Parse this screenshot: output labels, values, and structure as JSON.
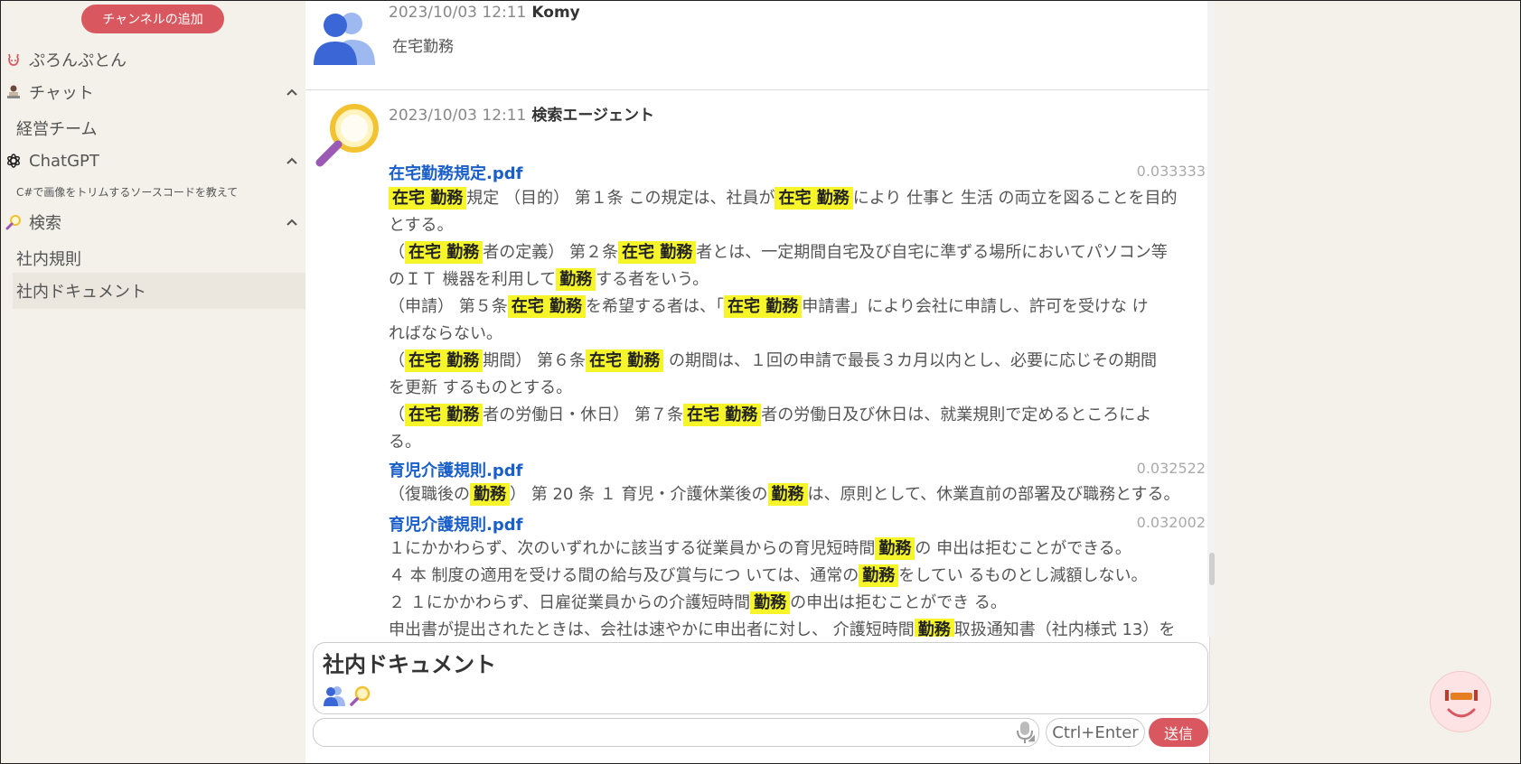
{
  "sidebar": {
    "add_channel": "チャンネルの追加",
    "items": [
      {
        "label": "ぷろんぷとん",
        "icon": "devil-face-icon"
      },
      {
        "label": "チャット",
        "icon": "person-at-desk-icon"
      },
      {
        "label": "経営チーム"
      },
      {
        "label": "ChatGPT",
        "icon": "openai-logo-icon"
      },
      {
        "label": "C#で画像をトリムするソースコードを教えて"
      },
      {
        "label": "検索",
        "icon": "magnifier-icon"
      },
      {
        "label": "社内規則"
      },
      {
        "label": "社内ドキュメント"
      }
    ]
  },
  "messages": {
    "user": {
      "timestamp": "2023/10/03 12:11",
      "name": "Komy",
      "text": "在宅勤務"
    },
    "agent": {
      "timestamp": "2023/10/03 12:11",
      "name": "検索エージェント"
    }
  },
  "results": {
    "r1": {
      "file": "在宅勤務規定.pdf",
      "score": "0.033333",
      "l1": {
        "h1": "在宅 勤務",
        "t1": "規定 （目的） 第１条 この規定は、社員が",
        "h2": "在宅 勤務",
        "t2": "により 仕事と 生活 の両立を図ることを目的"
      },
      "l2": {
        "t1": "とする。"
      },
      "l3": {
        "t0": "（",
        "h1": "在宅 勤務",
        "t1": "者の定義） 第２条",
        "h2": "在宅 勤務",
        "t2": "者とは、一定期間自宅及び自宅に準ずる場所においてパソコン等"
      },
      "l4": {
        "t0": "のＩＴ 機器を利用して",
        "h1": "勤務",
        "t1": "する者をいう。"
      },
      "l5": {
        "t0": "（申請） 第５条",
        "h1": "在宅 勤務",
        "t1": "を希望する者は、「",
        "h2": "在宅 勤務",
        "t2": "申請書」により会社に申請し、許可を受けな け"
      },
      "l6": {
        "t0": "ればならない。"
      },
      "l7": {
        "t0": "（",
        "h1": "在宅 勤務",
        "t1": "期間） 第６条",
        "h2": "在宅 勤務",
        "t2": " の期間は、１回の申請で最長３カ月以内とし、必要に応じその期間"
      },
      "l8": {
        "t0": "を更新 するものとする。"
      },
      "l9": {
        "t0": "（",
        "h1": "在宅 勤務",
        "t1": "者の労働日・休日） 第７条",
        "h2": "在宅 勤務",
        "t2": "者の労働日及び休日は、就業規則で定めるところによ"
      },
      "l10": {
        "t0": "る。"
      }
    },
    "r2": {
      "file": "育児介護規則.pdf",
      "score": "0.032522",
      "l1": {
        "t0": "（復職後の",
        "h1": "勤務",
        "t1": "） 第 20 条 １ 育児・介護休業後の",
        "h2": "勤務",
        "t2": "は、原則として、休業直前の部署及び職務とする。"
      }
    },
    "r3": {
      "file": "育児介護規則.pdf",
      "score": "0.032002",
      "l1": {
        "t0": "１にかかわらず、次のいずれかに該当する従業員からの育児短時間",
        "h1": "勤務",
        "t1": "の 申出は拒むことができる。"
      },
      "l2": {
        "t0": "４ 本 制度の適用を受ける間の給与及び賞与につ いては、通常の",
        "h1": "勤務",
        "t1": "をしてい るものとし減額しない。"
      },
      "l3": {
        "t0": "２ １にかかわらず、日雇従業員からの介護短時間",
        "h1": "勤務",
        "t1": "の申出は拒むことができ る。"
      },
      "l4": {
        "t0": "申出書が提出されたときは、会社は速やかに申出者に対し、 介護短時間",
        "h1": "勤務",
        "t1": "取扱通知書（社内様式 13）を"
      }
    }
  },
  "composer": {
    "channel_title": "社内ドキュメント",
    "input_value": "",
    "ctrl_enter": "Ctrl+Enter",
    "send": "送信"
  },
  "colors": {
    "accent": "#d9585f",
    "highlight": "#f5f52a",
    "link": "#1a5fc9"
  }
}
